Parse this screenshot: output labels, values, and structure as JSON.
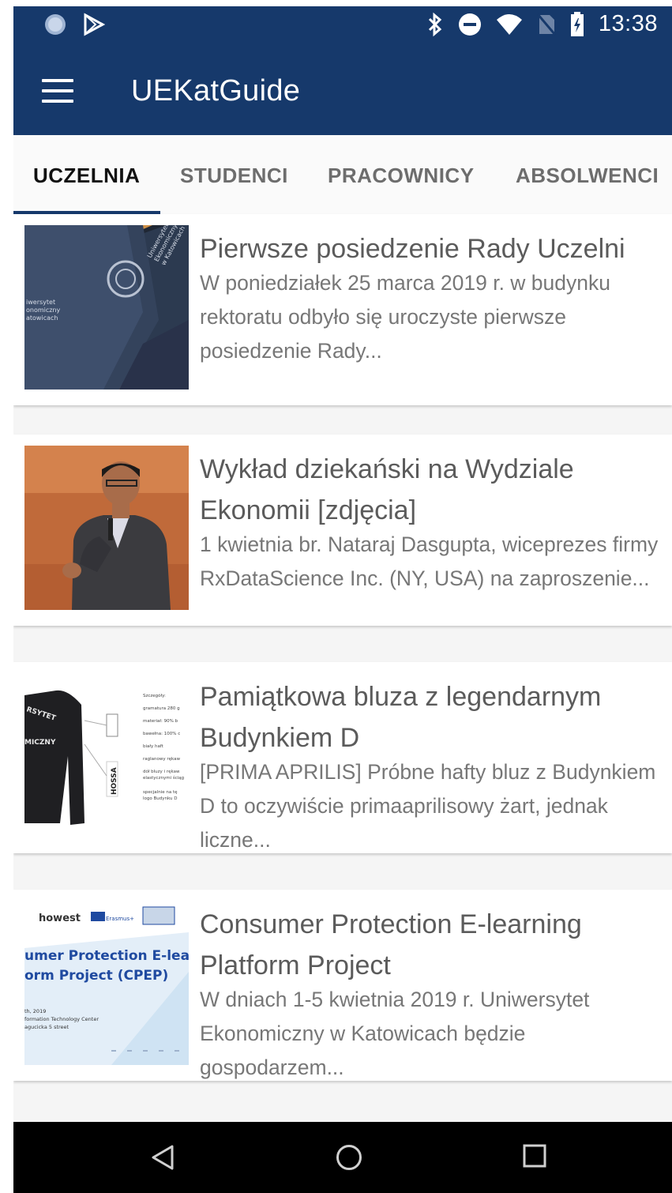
{
  "status_bar": {
    "time": "13:38",
    "left_icons": [
      "circle-notification-icon",
      "play-store-icon"
    ],
    "right_icons": [
      "bluetooth-icon",
      "do-not-disturb-icon",
      "wifi-icon",
      "no-sim-icon",
      "battery-charging-icon"
    ]
  },
  "app_bar": {
    "title": "UEKatGuide",
    "menu_icon": "hamburger-menu-icon",
    "color": "#16396b"
  },
  "tabs": {
    "items": [
      {
        "label": "UCZELNIA",
        "active": true
      },
      {
        "label": "STUDENCI",
        "active": false
      },
      {
        "label": "PRACOWNICY",
        "active": false
      },
      {
        "label": "ABSOLWENCI",
        "active": false
      }
    ]
  },
  "articles": [
    {
      "title": "Pierwsze posiedzenie Rady Uczelni",
      "description": "W poniedziałek 25 marca 2019 r. w budynku rektoratu odbyło się uroczyste pierwsze posiedzenie Rady...",
      "image_text": [
        "iwersytet",
        "onomiczny",
        "atowicach",
        "Uniwersytet",
        "Ekonomiczny",
        "w Katowicach"
      ]
    },
    {
      "title": "Wykład dziekański na Wydziale Ekonomii [zdjęcia]",
      "description": "1 kwietnia br. Nataraj Dasgupta, wiceprezes firmy RxDataScience Inc. (NY, USA) na zaproszenie..."
    },
    {
      "title": "Pamiątkowa bluza z legendarnym Budynkiem D",
      "description": "[PRIMA APRILIS] Próbne hafty bluz z Budynkiem D to oczywiście primaaprilisowy żart, jednak liczne...",
      "image_text": [
        "RSYTET",
        "MICZNY",
        "HOSSA",
        "Szczegóły:",
        "gramatura 280 g",
        "materiał: 90% b",
        "bawełna: 100% c",
        "biały haft",
        "raglanowy rękaw",
        "dół bluzy i rękaw",
        "elastycznymi ściąg",
        "specjalnie na tę",
        "logo Budynku D"
      ]
    },
    {
      "title": "Consumer Protection E-learning Platform Project",
      "description": "W dniach 1-5 kwietnia 2019 r. Uniwersytet Ekonomiczny w Katowicach będzie gospodarzem...",
      "image_text": [
        "howest",
        "Erasmus+",
        "umer Protection E-lea",
        "orm Project (CPEP)",
        "th, 2019",
        "formation Technology Center",
        "agucicka 5 street"
      ]
    }
  ],
  "nav_bar": {
    "icons": [
      "back-icon",
      "home-icon",
      "recents-icon"
    ]
  }
}
